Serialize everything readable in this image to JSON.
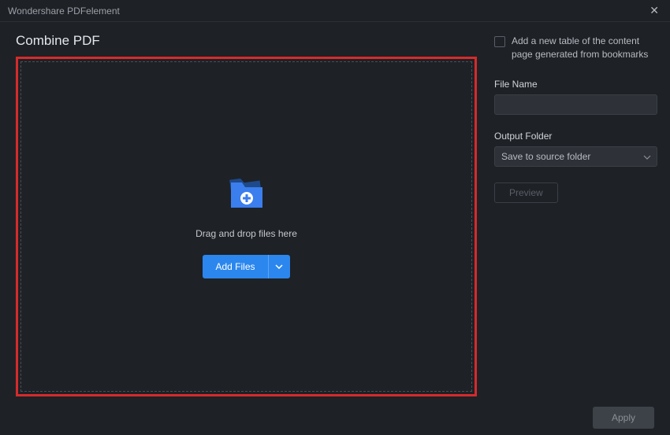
{
  "titlebar": {
    "app_name": "Wondershare PDFelement"
  },
  "main": {
    "title": "Combine PDF",
    "drop_text": "Drag and drop files here",
    "add_files_label": "Add Files"
  },
  "sidebar": {
    "checkbox_label": "Add a new table of the content page generated from bookmarks",
    "file_name_label": "File Name",
    "file_name_value": "",
    "output_folder_label": "Output Folder",
    "output_folder_value": "Save to source folder",
    "preview_label": "Preview"
  },
  "footer": {
    "apply_label": "Apply"
  }
}
